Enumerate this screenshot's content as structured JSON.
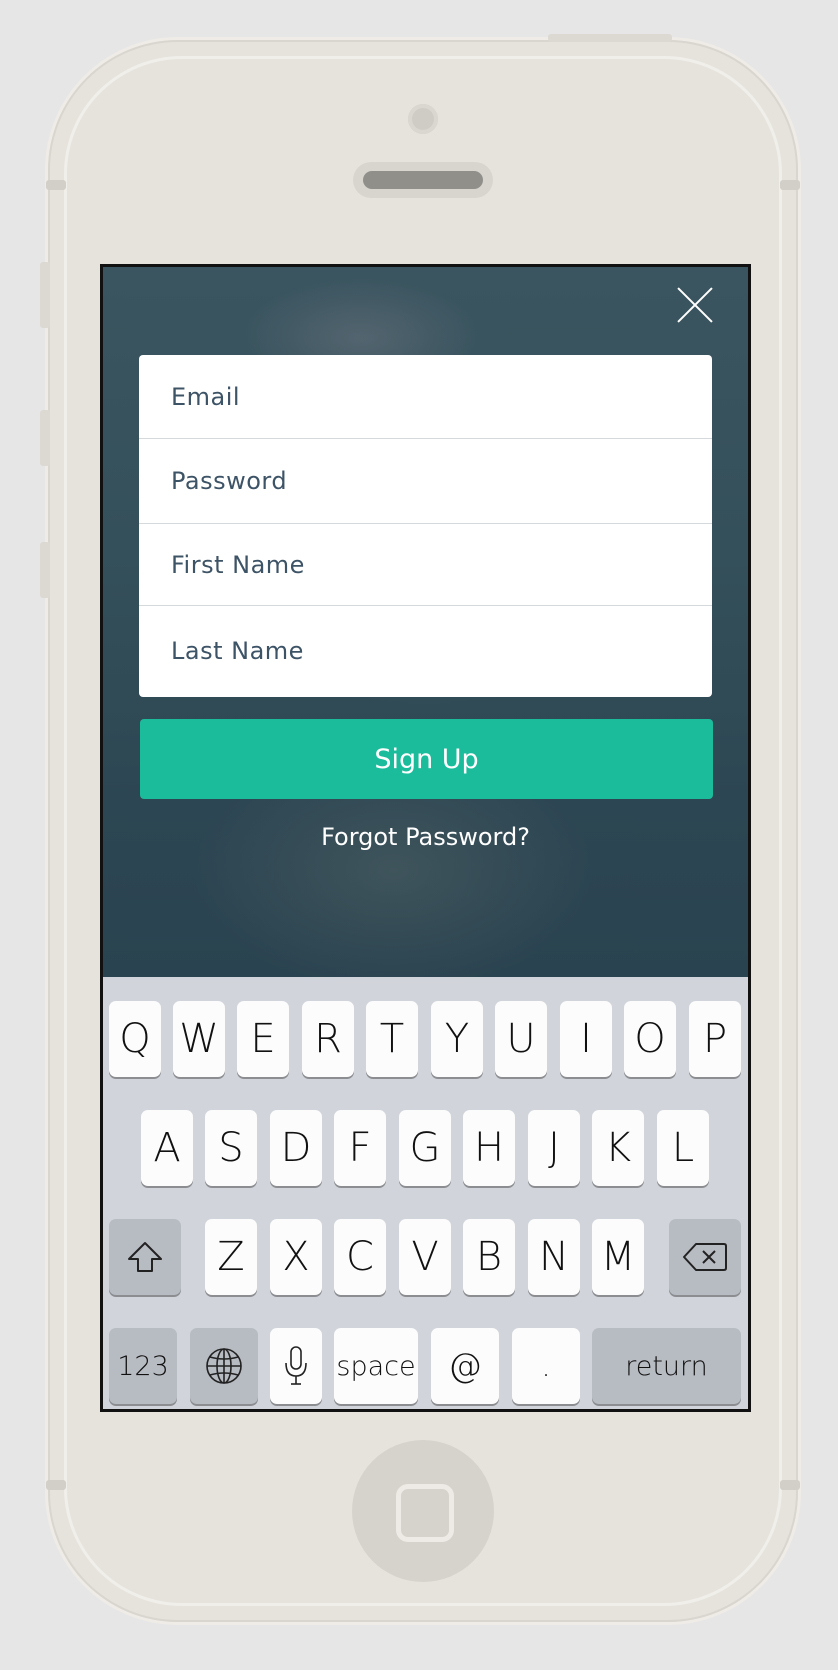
{
  "screen": {
    "close_icon": "close-icon",
    "form": {
      "email_placeholder": "Email",
      "password_placeholder": "Password",
      "first_name_placeholder": "First Name",
      "last_name_placeholder": "Last Name"
    },
    "signup_label": "Sign Up",
    "forgot_label": "Forgot Password?",
    "accent_color": "#1bbc9b"
  },
  "keyboard": {
    "row1": [
      "Q",
      "W",
      "E",
      "R",
      "T",
      "Y",
      "U",
      "I",
      "O",
      "P"
    ],
    "row2": [
      "A",
      "S",
      "D",
      "F",
      "G",
      "H",
      "J",
      "K",
      "L"
    ],
    "row3": [
      "Z",
      "X",
      "C",
      "V",
      "B",
      "N",
      "M"
    ],
    "shift_icon": "shift-icon",
    "delete_icon": "backspace-icon",
    "numbers_label": "123",
    "globe_icon": "globe-icon",
    "mic_icon": "microphone-icon",
    "space_label": "space",
    "at_label": "@",
    "period_label": ".",
    "return_label": "return"
  }
}
